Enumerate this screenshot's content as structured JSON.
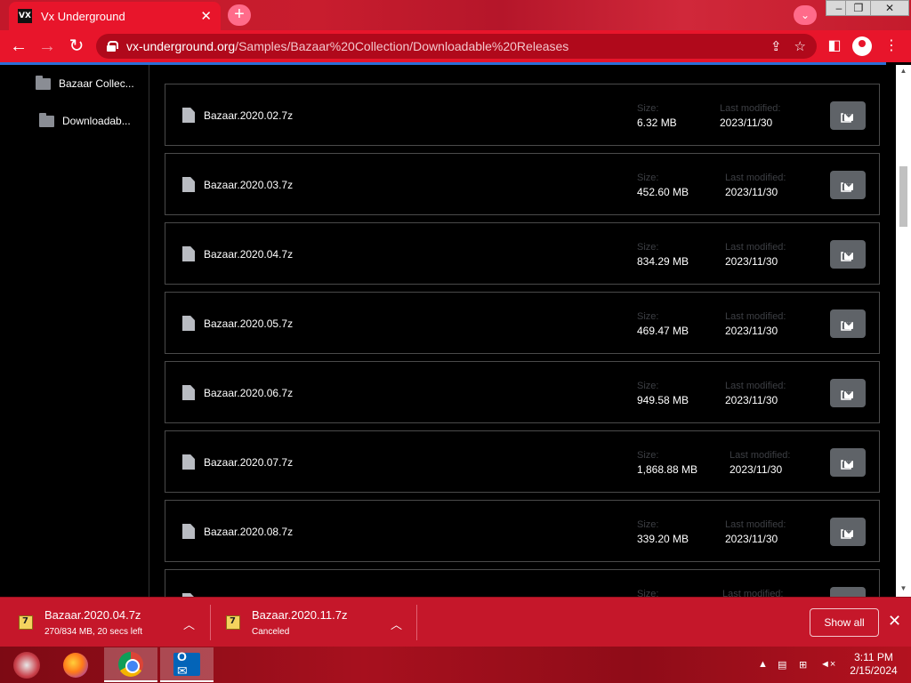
{
  "browser": {
    "tab_title": "Vx Underground",
    "favicon_text": "VX",
    "url_host": "vx-underground.org",
    "url_path": "/Samples/Bazaar%20Collection/Downloadable%20Releases",
    "accent_color": "#e8152b"
  },
  "sidebar": {
    "items": [
      {
        "label": "Bazaar Collec...",
        "icon": "folder-icon"
      },
      {
        "label": "Downloadab...",
        "icon": "folder-icon"
      }
    ]
  },
  "files": {
    "size_label": "Size:",
    "modified_label": "Last modified:",
    "rows": [
      {
        "name": "Bazaar.2020.02.7z",
        "size": "6.32 MB",
        "modified": "2023/11/30"
      },
      {
        "name": "Bazaar.2020.03.7z",
        "size": "452.60 MB",
        "modified": "2023/11/30"
      },
      {
        "name": "Bazaar.2020.04.7z",
        "size": "834.29 MB",
        "modified": "2023/11/30"
      },
      {
        "name": "Bazaar.2020.05.7z",
        "size": "469.47 MB",
        "modified": "2023/11/30"
      },
      {
        "name": "Bazaar.2020.06.7z",
        "size": "949.58 MB",
        "modified": "2023/11/30"
      },
      {
        "name": "Bazaar.2020.07.7z",
        "size": "1,868.88 MB",
        "modified": "2023/11/30"
      },
      {
        "name": "Bazaar.2020.08.7z",
        "size": "339.20 MB",
        "modified": "2023/11/30"
      }
    ]
  },
  "downloads": {
    "items": [
      {
        "name": "Bazaar.2020.04.7z",
        "status": "270/834 MB, 20 secs left"
      },
      {
        "name": "Bazaar.2020.11.7z",
        "status": "Canceled"
      }
    ],
    "show_all_label": "Show all"
  },
  "taskbar": {
    "time": "3:11 PM",
    "date": "2/15/2024"
  }
}
